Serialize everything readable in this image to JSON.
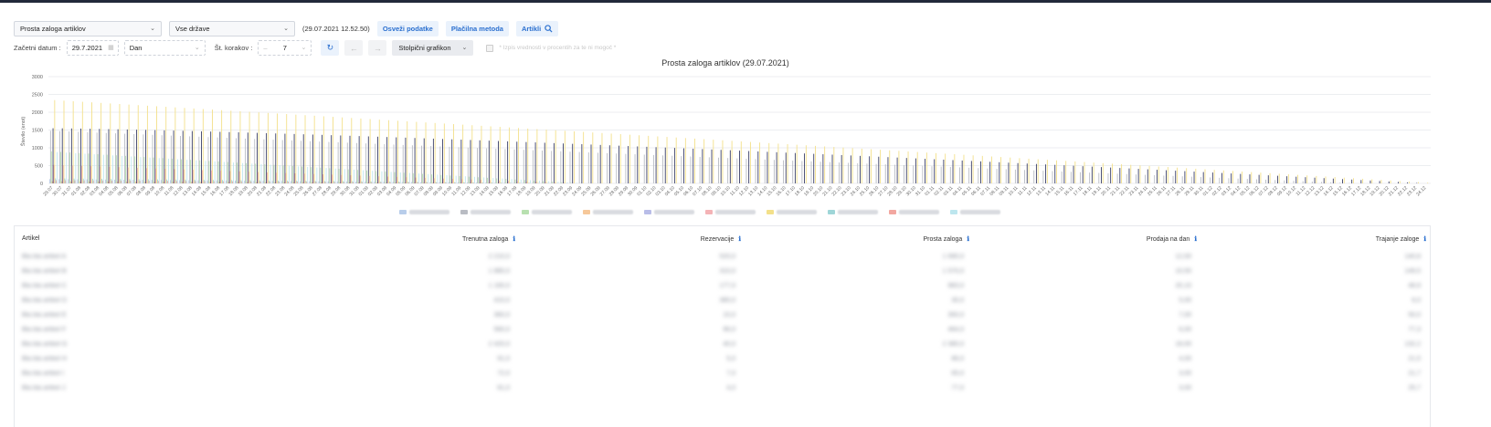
{
  "toolbar": {
    "report_select": "Prosta zaloga artiklov",
    "country_select": "Vse države",
    "timestamp": "(29.07.2021 12.52.50)",
    "refresh_label": "Osveži podatke",
    "payment_label": "Plačilna metoda",
    "articles_label": "Artikli",
    "start_date_label": "Začetni datum :",
    "start_date_value": "29.7.2021",
    "period_select": "Dan",
    "steps_label": "Št. korakov :",
    "steps_value": "7",
    "chart_type_select": "Stolpični grafikon",
    "checkbox_note": "* Izpis vrednosti v procentih za te ni mogoč *"
  },
  "colors": {
    "accent": "#2a6fcf"
  },
  "chart_data": {
    "type": "bar",
    "title": "Prosta zaloga artiklov (29.07.2021)",
    "ylabel": "Število (enot)",
    "ylim": [
      0,
      3000
    ],
    "yticks": [
      0,
      500,
      1000,
      1500,
      2000,
      2500,
      3000
    ],
    "categories": [
      "29.07",
      "30.07",
      "31.07",
      "01.08",
      "02.08",
      "03.08",
      "04.08",
      "05.08",
      "06.08",
      "07.08",
      "08.08",
      "09.08",
      "10.08",
      "11.08",
      "12.08",
      "13.08",
      "14.08",
      "15.08",
      "16.08",
      "17.08",
      "18.08",
      "19.08",
      "20.08",
      "21.08",
      "22.08",
      "23.08",
      "24.08",
      "25.08",
      "26.08",
      "27.08",
      "28.08",
      "29.08",
      "30.08",
      "31.08",
      "01.09",
      "02.09",
      "03.09",
      "04.09",
      "05.09",
      "06.09",
      "07.09",
      "08.09",
      "09.09",
      "10.09",
      "11.09",
      "12.09",
      "13.09",
      "14.09",
      "15.09",
      "16.09",
      "17.09",
      "18.09",
      "19.09",
      "20.09",
      "21.09",
      "22.09",
      "23.09",
      "24.09",
      "25.09",
      "26.09",
      "27.09",
      "28.09",
      "29.09",
      "30.09",
      "01.10",
      "02.10",
      "03.10",
      "04.10",
      "05.10",
      "06.10",
      "07.10",
      "08.10",
      "09.10",
      "10.10",
      "11.10",
      "12.10",
      "13.10",
      "14.10",
      "15.10",
      "16.10",
      "17.10",
      "18.10",
      "19.10",
      "20.10",
      "21.10",
      "22.10",
      "23.10",
      "24.10",
      "25.10",
      "26.10",
      "27.10",
      "28.10",
      "29.10",
      "30.10",
      "31.10",
      "01.11",
      "02.11",
      "03.11",
      "04.11",
      "05.11",
      "06.11",
      "07.11",
      "08.11",
      "09.11",
      "10.11",
      "11.11",
      "12.11",
      "13.11",
      "14.11",
      "15.11",
      "16.11",
      "17.11",
      "18.11",
      "19.11",
      "20.11",
      "21.11",
      "22.11",
      "23.11",
      "24.11",
      "25.11",
      "26.11",
      "27.11",
      "28.11",
      "29.11",
      "30.11",
      "01.12",
      "02.12",
      "03.12",
      "04.12",
      "05.12",
      "06.12",
      "07.12",
      "08.12",
      "09.12",
      "10.12",
      "11.12",
      "12.12",
      "13.12",
      "14.12",
      "15.12",
      "16.12",
      "17.12",
      "18.12",
      "19.12",
      "20.12",
      "21.12",
      "22.12",
      "23.12",
      "24.12"
    ],
    "series_colors": [
      "#b8cdea",
      "#b9bcc3",
      "#b8e0b0",
      "#f6c89a",
      "#b9bde8",
      "#f4b3b6",
      "#f3e08a",
      "#9fd6d8",
      "#f2a7a0",
      "#bde6ee"
    ],
    "series_shape": [
      {
        "start": 120,
        "end_frac": 0.0
      },
      {
        "start": 1480,
        "end_frac": 0.0
      },
      {
        "start": 900,
        "end_frac": 0.0
      },
      {
        "start": 60,
        "end_frac": 0.0
      },
      {
        "start": 1550,
        "end_frac": 0.0
      },
      {
        "start": 520,
        "end_frac": 0.0
      },
      {
        "start": 2340,
        "end_frac": 0.0
      },
      {
        "start": 140,
        "end_frac": 0.0
      },
      {
        "start": 90,
        "end_frac": 0.0
      },
      {
        "start": 880,
        "end_frac": 0.0
      }
    ]
  },
  "table": {
    "headers": [
      "Artikel",
      "Trenutna zaloga",
      "Rezervacije",
      "Prosta zaloga",
      "Prodaja na dan",
      "Trajanje zaloge"
    ],
    "rows": [
      [
        "Bla bla artikel A",
        "2 210,0",
        "520,0",
        "1 690,0",
        "12,00",
        "140,8"
      ],
      [
        "Bla bla artikel B",
        "1 880,0",
        "310,0",
        "1 570,0",
        "10,50",
        "149,5"
      ],
      [
        "Bla bla artikel C",
        "1 160,0",
        "177,0",
        "983,0",
        "20,10",
        "48,9"
      ],
      [
        "Bla bla artikel D",
        "410,0",
        "380,0",
        "30,0",
        "5,00",
        "6,0"
      ],
      [
        "Bla bla artikel E",
        "360,0",
        "10,0",
        "350,0",
        "7,00",
        "50,0"
      ],
      [
        "Bla bla artikel F",
        "560,0",
        "96,0",
        "464,0",
        "6,00",
        "77,3"
      ],
      [
        "Bla bla artikel G",
        "2 420,0",
        "40,0",
        "2 380,0",
        "18,00",
        "132,2"
      ],
      [
        "Bla bla artikel H",
        "91,0",
        "5,0",
        "86,0",
        "4,00",
        "21,5"
      ],
      [
        "Bla bla artikel I",
        "72,0",
        "7,0",
        "65,0",
        "3,00",
        "21,7"
      ],
      [
        "Bla bla artikel J",
        "81,0",
        "4,0",
        "77,0",
        "3,00",
        "25,7"
      ]
    ]
  }
}
